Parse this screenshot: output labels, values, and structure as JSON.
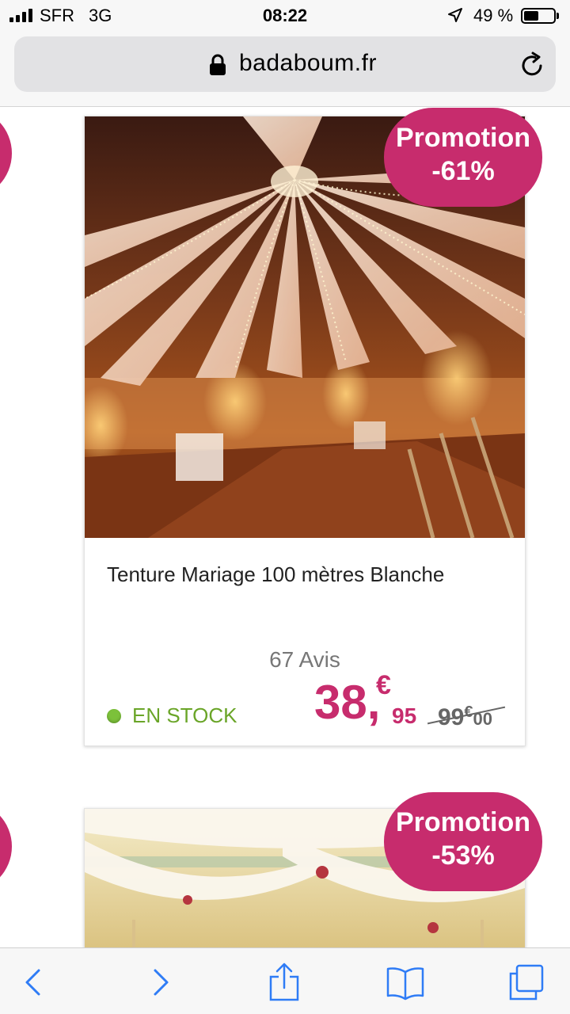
{
  "status_bar": {
    "carrier": "SFR",
    "network": "3G",
    "time": "08:22",
    "battery_percent": "49 %",
    "battery_level": 0.49,
    "icons": [
      "signal-bars-icon",
      "location-arrow-icon",
      "battery-icon"
    ]
  },
  "browser": {
    "url": "badaboum.fr",
    "icons": [
      "lock-icon",
      "reload-icon"
    ]
  },
  "products": [
    {
      "promo_label": "Promotion",
      "promo_discount": "-61%",
      "title": "Tenture Mariage 100 mètres Blanche",
      "reviews": "67 Avis",
      "stock": "EN STOCK",
      "price_int": "38,",
      "price_currency": "€",
      "price_cents": "95",
      "old_price_int": "99",
      "old_price_currency": "€",
      "old_price_cents": "00"
    },
    {
      "promo_label": "Promotion",
      "promo_discount": "-53%"
    }
  ],
  "toolbar": {
    "icons": [
      "back-icon",
      "forward-icon",
      "share-icon",
      "bookmarks-icon",
      "tabs-icon"
    ]
  },
  "colors": {
    "accent": "#c72c6d",
    "stock_green": "#6aa528",
    "ios_blue": "#2f7cf6"
  }
}
